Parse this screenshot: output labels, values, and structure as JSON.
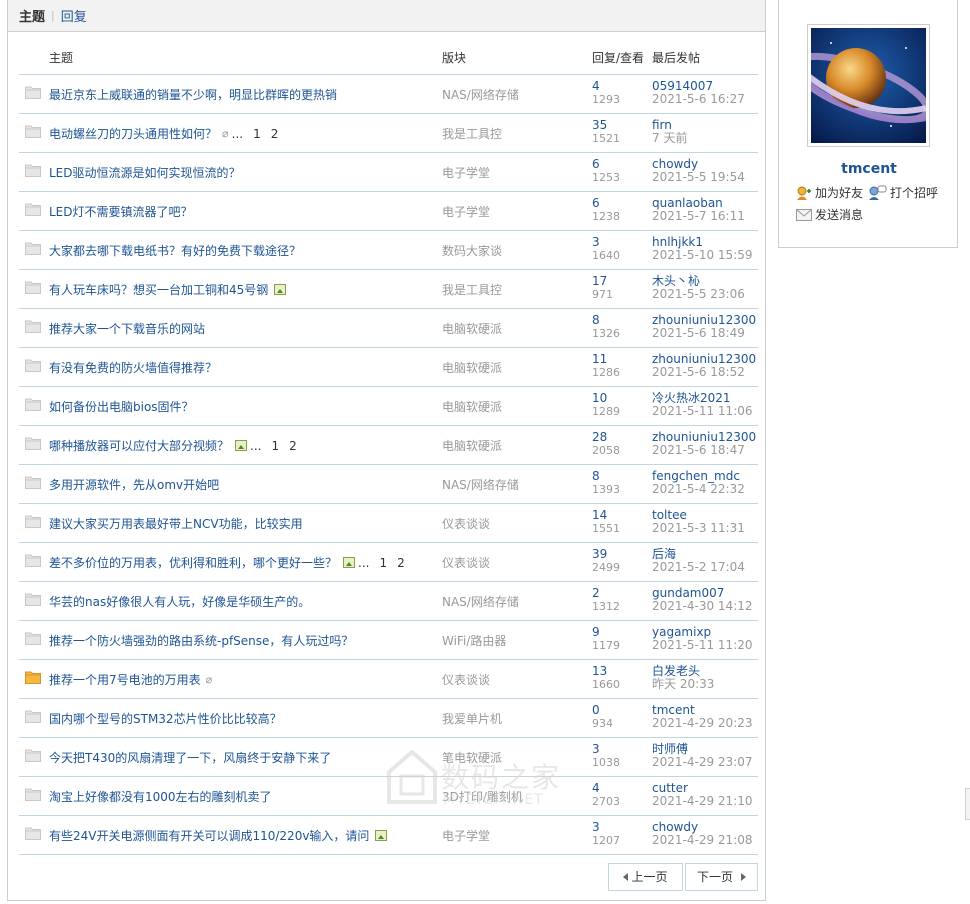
{
  "tabs": {
    "active": "主题",
    "other": "回复"
  },
  "columns": {
    "subject": "主题",
    "forum": "版块",
    "stats": "回复/查看",
    "last": "最后发帖"
  },
  "threads": [
    {
      "title": "最近京东上威联通的销量不少啊，明显比群晖的更热销",
      "forum": "NAS/网络存储",
      "replies": "4",
      "views": "1293",
      "last_user": "05914007",
      "last_time": "2021-5-6 16:27",
      "clip": false,
      "image": false,
      "pages": [],
      "folder_color": "gray"
    },
    {
      "title": "电动螺丝刀的刀头通用性如何？",
      "forum": "我是工具控",
      "replies": "35",
      "views": "1521",
      "last_user": "firn",
      "last_time": "7 天前",
      "clip": true,
      "image": false,
      "pages": [
        "1",
        "2"
      ],
      "folder_color": "gray"
    },
    {
      "title": "LED驱动恒流源是如何实现恒流的？",
      "forum": "电子学堂",
      "replies": "6",
      "views": "1253",
      "last_user": "chowdy",
      "last_time": "2021-5-5 19:54",
      "clip": false,
      "image": false,
      "pages": [],
      "folder_color": "gray"
    },
    {
      "title": "LED灯不需要镇流器了吧？",
      "forum": "电子学堂",
      "replies": "6",
      "views": "1238",
      "last_user": "quanlaoban",
      "last_time": "2021-5-7 16:11",
      "clip": false,
      "image": false,
      "pages": [],
      "folder_color": "gray"
    },
    {
      "title": "大家都去哪下载电纸书？有好的免费下载途径？",
      "forum": "数码大家谈",
      "replies": "3",
      "views": "1640",
      "last_user": "hnlhjkk1",
      "last_time": "2021-5-10 15:59",
      "clip": false,
      "image": false,
      "pages": [],
      "folder_color": "gray"
    },
    {
      "title": "有人玩车床吗？想买一台加工铜和45号钢",
      "forum": "我是工具控",
      "replies": "17",
      "views": "971",
      "last_user": "木头丶杺",
      "last_time": "2021-5-5 23:06",
      "clip": false,
      "image": true,
      "pages": [],
      "folder_color": "gray"
    },
    {
      "title": "推荐大家一个下载音乐的网站",
      "forum": "电脑软硬派",
      "replies": "8",
      "views": "1326",
      "last_user": "zhouniuniu12300",
      "last_time": "2021-5-6 18:49",
      "clip": false,
      "image": false,
      "pages": [],
      "folder_color": "gray"
    },
    {
      "title": "有没有免费的防火墙值得推荐？",
      "forum": "电脑软硬派",
      "replies": "11",
      "views": "1286",
      "last_user": "zhouniuniu12300",
      "last_time": "2021-5-6 18:52",
      "clip": false,
      "image": false,
      "pages": [],
      "folder_color": "gray"
    },
    {
      "title": "如何备份出电脑bios固件？",
      "forum": "电脑软硬派",
      "replies": "10",
      "views": "1289",
      "last_user": "冷火热冰2021",
      "last_time": "2021-5-11 11:06",
      "clip": false,
      "image": false,
      "pages": [],
      "folder_color": "gray"
    },
    {
      "title": "哪种播放器可以应付大部分视频？",
      "forum": "电脑软硬派",
      "replies": "28",
      "views": "2058",
      "last_user": "zhouniuniu12300",
      "last_time": "2021-5-6 18:47",
      "clip": false,
      "image": true,
      "pages": [
        "1",
        "2"
      ],
      "folder_color": "gray"
    },
    {
      "title": "多用开源软件，先从omv开始吧",
      "forum": "NAS/网络存储",
      "replies": "8",
      "views": "1393",
      "last_user": "fengchen_mdc",
      "last_time": "2021-5-4 22:32",
      "clip": false,
      "image": false,
      "pages": [],
      "folder_color": "gray"
    },
    {
      "title": "建议大家买万用表最好带上NCV功能，比较实用",
      "forum": "仪表谈谈",
      "replies": "14",
      "views": "1551",
      "last_user": "toltee",
      "last_time": "2021-5-3 11:31",
      "clip": false,
      "image": false,
      "pages": [],
      "folder_color": "gray"
    },
    {
      "title": "差不多价位的万用表，优利得和胜利，哪个更好一些？",
      "forum": "仪表谈谈",
      "replies": "39",
      "views": "2499",
      "last_user": "后海",
      "last_time": "2021-5-2 17:04",
      "clip": false,
      "image": true,
      "pages": [
        "1",
        "2"
      ],
      "folder_color": "gray"
    },
    {
      "title": "华芸的nas好像很人有人玩，好像是华硕生产的。",
      "forum": "NAS/网络存储",
      "replies": "2",
      "views": "1312",
      "last_user": "gundam007",
      "last_time": "2021-4-30 14:12",
      "clip": false,
      "image": false,
      "pages": [],
      "folder_color": "gray"
    },
    {
      "title": "推荐一个防火墙强劲的路由系统-pfSense，有人玩过吗？",
      "forum": "WiFi/路由器",
      "replies": "9",
      "views": "1179",
      "last_user": "yagamixp",
      "last_time": "2021-5-11 11:20",
      "clip": false,
      "image": false,
      "pages": [],
      "folder_color": "gray"
    },
    {
      "title": "推荐一个用7号电池的万用表",
      "forum": "仪表谈谈",
      "replies": "13",
      "views": "1660",
      "last_user": "白发老头",
      "last_time": "昨天 20:33",
      "clip": true,
      "image": false,
      "pages": [],
      "folder_color": "orange"
    },
    {
      "title": "国内哪个型号的STM32芯片性价比比较高？",
      "forum": "我爱单片机",
      "replies": "0",
      "views": "934",
      "last_user": "tmcent",
      "last_time": "2021-4-29 20:23",
      "clip": false,
      "image": false,
      "pages": [],
      "folder_color": "gray"
    },
    {
      "title": "今天把T430的风扇清理了一下，风扇终于安静下来了",
      "forum": "笔电软硬派",
      "replies": "3",
      "views": "1038",
      "last_user": "时师傅",
      "last_time": "2021-4-29 23:07",
      "clip": false,
      "image": false,
      "pages": [],
      "folder_color": "gray"
    },
    {
      "title": "淘宝上好像都没有1000左右的雕刻机卖了",
      "forum": "3D打印/雕刻机",
      "replies": "4",
      "views": "2703",
      "last_user": "cutter",
      "last_time": "2021-4-29 21:10",
      "clip": false,
      "image": false,
      "pages": [],
      "folder_color": "gray"
    },
    {
      "title": "有些24V开关电源侧面有开关可以调成110/220v输入，请问",
      "forum": "电子学堂",
      "replies": "3",
      "views": "1207",
      "last_user": "chowdy",
      "last_time": "2021-4-29 21:08",
      "clip": false,
      "image": true,
      "pages": [],
      "folder_color": "gray"
    }
  ],
  "ellipsis": "...",
  "pagination": {
    "prev": "上一页",
    "next": "下一页"
  },
  "profile": {
    "username": "tmcent",
    "add_friend": "加为好友",
    "greet": "打个招呼",
    "send_message": "发送消息"
  },
  "watermark": {
    "main": "数码之家",
    "sub": "MYDIGIT.NET"
  },
  "colors": {
    "link": "#1e5494",
    "muted": "#999999",
    "row_border": "#c2d5e3",
    "folder_gray": "#e6e6e6",
    "folder_orange": "#f6b73c"
  }
}
